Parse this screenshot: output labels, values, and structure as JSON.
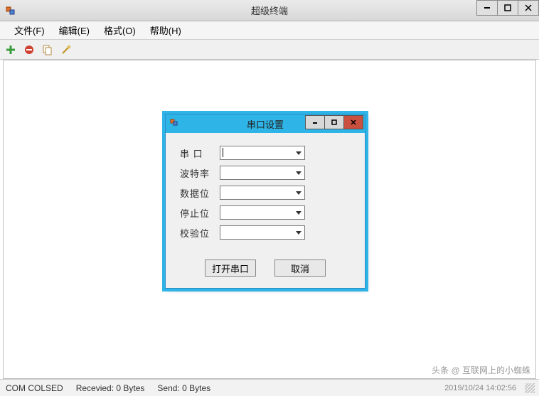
{
  "main_window": {
    "title": "超级终端",
    "menu": {
      "file": "文件(F)",
      "edit": "编辑(E)",
      "format": "格式(O)",
      "help": "帮助(H)"
    }
  },
  "dialog": {
    "title": "串口设置",
    "fields": {
      "port": "串  口",
      "baud": "波特率",
      "databits": "数据位",
      "stopbits": "停止位",
      "parity": "校验位"
    },
    "values": {
      "port": "",
      "baud": "",
      "databits": "",
      "stopbits": "",
      "parity": ""
    },
    "buttons": {
      "open": "打开串口",
      "cancel": "取消"
    }
  },
  "status": {
    "conn": "COM COLSED",
    "recv": "Recevied: 0 Bytes",
    "send": "Send: 0 Bytes",
    "timestamp": "2019/10/24 14:02:56"
  },
  "watermark": "头条 @ 互联网上的小蜘蛛"
}
